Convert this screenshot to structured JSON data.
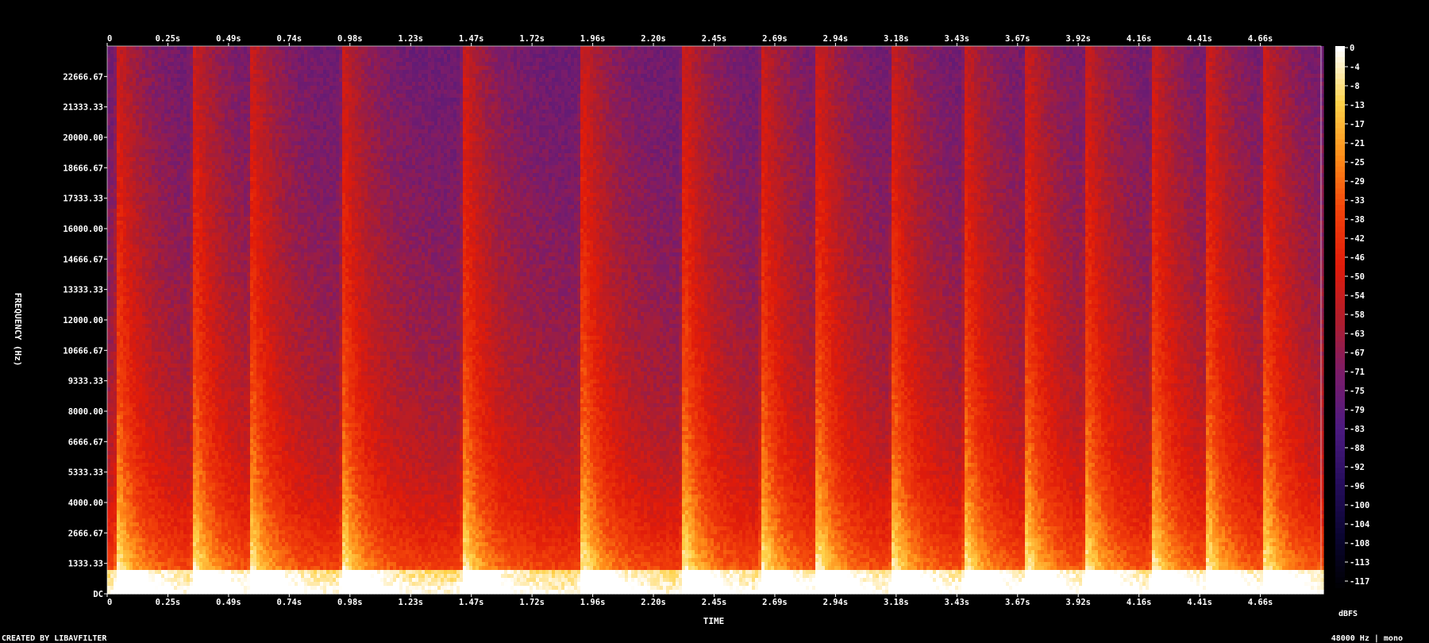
{
  "chart_data": {
    "type": "heatmap",
    "xlabel": "TIME",
    "ylabel": "FREQUENCY (Hz)",
    "x_ticks": [
      "0",
      "0.25s",
      "0.49s",
      "0.74s",
      "0.98s",
      "1.23s",
      "1.47s",
      "1.72s",
      "1.96s",
      "2.20s",
      "2.45s",
      "2.69s",
      "2.94s",
      "3.18s",
      "3.43s",
      "3.67s",
      "3.92s",
      "4.16s",
      "4.41s",
      "4.66s"
    ],
    "x_tick_values": [
      0,
      0.245,
      0.49,
      0.735,
      0.98,
      1.225,
      1.47,
      1.715,
      1.96,
      2.205,
      2.45,
      2.695,
      2.94,
      3.185,
      3.43,
      3.675,
      3.92,
      4.165,
      4.41,
      4.655
    ],
    "xlim": [
      0,
      4.9
    ],
    "y_ticks": [
      "DC",
      "1333.33",
      "2666.67",
      "4000.00",
      "5333.33",
      "6666.67",
      "8000.00",
      "9333.33",
      "10666.67",
      "12000.00",
      "13333.33",
      "14666.67",
      "16000.00",
      "17333.33",
      "18666.67",
      "20000.00",
      "21333.33",
      "22666.67"
    ],
    "y_tick_values": [
      0,
      1333.33,
      2666.67,
      4000,
      5333.33,
      6666.67,
      8000,
      9333.33,
      10666.67,
      12000,
      13333.33,
      14666.67,
      16000,
      17333.33,
      18666.67,
      20000,
      21333.33,
      22666.67
    ],
    "ylim": [
      0,
      24000
    ],
    "colorbar": {
      "label": "dBFS",
      "ticks": [
        "0",
        "-4",
        "-8",
        "-13",
        "-17",
        "-21",
        "-25",
        "-29",
        "-33",
        "-38",
        "-42",
        "-46",
        "-50",
        "-54",
        "-58",
        "-63",
        "-67",
        "-71",
        "-75",
        "-79",
        "-83",
        "-88",
        "-92",
        "-96",
        "-100",
        "-104",
        "-108",
        "-113",
        "-117"
      ],
      "range": [
        -120,
        0
      ],
      "colors": [
        "#000000",
        "#0a0530",
        "#250d5c",
        "#4c1a80",
        "#7a1c6a",
        "#b01d2c",
        "#e01b0a",
        "#f2410a",
        "#ff8c18",
        "#ffd24a",
        "#ffffff"
      ]
    },
    "onsets_s": [
      0.05,
      0.36,
      0.59,
      0.96,
      1.45,
      1.93,
      2.34,
      2.65,
      2.88,
      3.18,
      3.47,
      3.72,
      3.96,
      4.23,
      4.45,
      4.68
    ]
  },
  "footer": {
    "credit": "CREATED BY LIBAVFILTER",
    "audio_info": "48000 Hz | mono"
  }
}
